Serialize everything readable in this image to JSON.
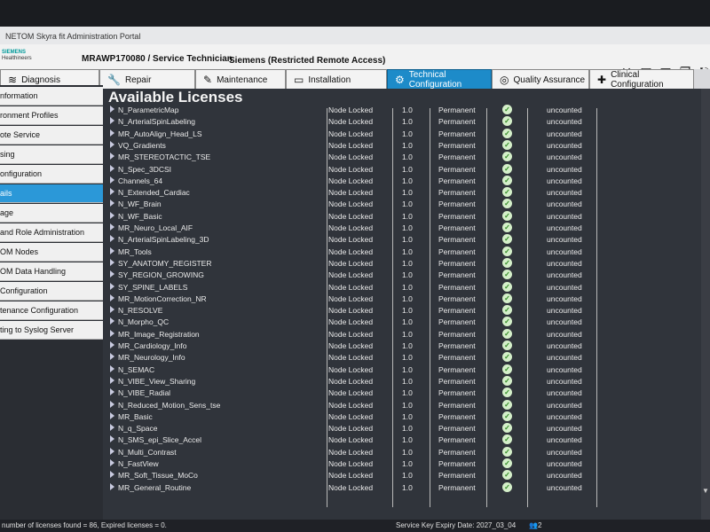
{
  "window": {
    "title": "MAGNETOM Skyra fit Administration Portal",
    "title_visible": "NETOM Skyra fit Administration Portal"
  },
  "header": {
    "logo_line1": "SIEMENS",
    "logo_line2": "Healthineers",
    "system_role": "MRAWP170080 / Service Technician",
    "access": "Siemens (Restricted Remote Access)"
  },
  "tabs": [
    {
      "label": "Diagnosis",
      "icon": "siemens-logo-icon"
    },
    {
      "label": "Repair",
      "icon": "wrench-icon"
    },
    {
      "label": "Maintenance",
      "icon": "edit-icon"
    },
    {
      "label": "Installation",
      "icon": "monitor-icon"
    },
    {
      "label": "Technical Configuration",
      "icon": "gears-icon",
      "active": true
    },
    {
      "label": "Quality Assurance",
      "icon": "award-icon"
    },
    {
      "label": "Clinical Configuration",
      "icon": "plus-icon"
    }
  ],
  "sidebar": {
    "items": [
      {
        "label": "nformation"
      },
      {
        "label": "ronment Profiles"
      },
      {
        "label": "ote Service"
      },
      {
        "label": "sing"
      },
      {
        "label": "onfiguration"
      },
      {
        "label": "ails",
        "active": true
      },
      {
        "label": "age"
      },
      {
        "label": " and Role Administration"
      },
      {
        "label": "OM Nodes"
      },
      {
        "label": "OM Data Handling"
      },
      {
        "label": "Configuration"
      },
      {
        "label": "tenance Configuration"
      },
      {
        "label": "ting to Syslog Server"
      }
    ]
  },
  "content": {
    "title": "Available Licenses",
    "licenses": [
      {
        "name": "N_ParametricMap",
        "type": "Node Locked",
        "count": "1.0",
        "validity": "Permanent",
        "status": "uncounted"
      },
      {
        "name": "N_ArterialSpinLabeling",
        "type": "Node Locked",
        "count": "1.0",
        "validity": "Permanent",
        "status": "uncounted"
      },
      {
        "name": "MR_AutoAlign_Head_LS",
        "type": "Node Locked",
        "count": "1.0",
        "validity": "Permanent",
        "status": "uncounted"
      },
      {
        "name": "VQ_Gradients",
        "type": "Node Locked",
        "count": "1.0",
        "validity": "Permanent",
        "status": "uncounted"
      },
      {
        "name": "MR_STEREOTACTIC_TSE",
        "type": "Node Locked",
        "count": "1.0",
        "validity": "Permanent",
        "status": "uncounted"
      },
      {
        "name": "N_Spec_3DCSI",
        "type": "Node Locked",
        "count": "1.0",
        "validity": "Permanent",
        "status": "uncounted"
      },
      {
        "name": "Channels_64",
        "type": "Node Locked",
        "count": "1.0",
        "validity": "Permanent",
        "status": "uncounted"
      },
      {
        "name": "N_Extended_Cardiac",
        "type": "Node Locked",
        "count": "1.0",
        "validity": "Permanent",
        "status": "uncounted"
      },
      {
        "name": "N_WF_Brain",
        "type": "Node Locked",
        "count": "1.0",
        "validity": "Permanent",
        "status": "uncounted"
      },
      {
        "name": "N_WF_Basic",
        "type": "Node Locked",
        "count": "1.0",
        "validity": "Permanent",
        "status": "uncounted"
      },
      {
        "name": "MR_Neuro_Local_AIF",
        "type": "Node Locked",
        "count": "1.0",
        "validity": "Permanent",
        "status": "uncounted"
      },
      {
        "name": "N_ArterialSpinLabeling_3D",
        "type": "Node Locked",
        "count": "1.0",
        "validity": "Permanent",
        "status": "uncounted"
      },
      {
        "name": "MR_Tools",
        "type": "Node Locked",
        "count": "1.0",
        "validity": "Permanent",
        "status": "uncounted"
      },
      {
        "name": "SY_ANATOMY_REGISTER",
        "type": "Node Locked",
        "count": "1.0",
        "validity": "Permanent",
        "status": "uncounted"
      },
      {
        "name": "SY_REGION_GROWING",
        "type": "Node Locked",
        "count": "1.0",
        "validity": "Permanent",
        "status": "uncounted"
      },
      {
        "name": "SY_SPINE_LABELS",
        "type": "Node Locked",
        "count": "1.0",
        "validity": "Permanent",
        "status": "uncounted"
      },
      {
        "name": "MR_MotionCorrection_NR",
        "type": "Node Locked",
        "count": "1.0",
        "validity": "Permanent",
        "status": "uncounted"
      },
      {
        "name": "N_RESOLVE",
        "type": "Node Locked",
        "count": "1.0",
        "validity": "Permanent",
        "status": "uncounted"
      },
      {
        "name": "N_Morpho_QC",
        "type": "Node Locked",
        "count": "1.0",
        "validity": "Permanent",
        "status": "uncounted"
      },
      {
        "name": "MR_Image_Registration",
        "type": "Node Locked",
        "count": "1.0",
        "validity": "Permanent",
        "status": "uncounted"
      },
      {
        "name": "MR_Cardiology_Info",
        "type": "Node Locked",
        "count": "1.0",
        "validity": "Permanent",
        "status": "uncounted"
      },
      {
        "name": "MR_Neurology_Info",
        "type": "Node Locked",
        "count": "1.0",
        "validity": "Permanent",
        "status": "uncounted"
      },
      {
        "name": "N_SEMAC",
        "type": "Node Locked",
        "count": "1.0",
        "validity": "Permanent",
        "status": "uncounted"
      },
      {
        "name": "N_VIBE_View_Sharing",
        "type": "Node Locked",
        "count": "1.0",
        "validity": "Permanent",
        "status": "uncounted"
      },
      {
        "name": "N_VIBE_Radial",
        "type": "Node Locked",
        "count": "1.0",
        "validity": "Permanent",
        "status": "uncounted"
      },
      {
        "name": "N_Reduced_Motion_Sens_tse",
        "type": "Node Locked",
        "count": "1.0",
        "validity": "Permanent",
        "status": "uncounted"
      },
      {
        "name": "MR_Basic",
        "type": "Node Locked",
        "count": "1.0",
        "validity": "Permanent",
        "status": "uncounted"
      },
      {
        "name": "N_q_Space",
        "type": "Node Locked",
        "count": "1.0",
        "validity": "Permanent",
        "status": "uncounted"
      },
      {
        "name": "N_SMS_epi_Slice_Accel",
        "type": "Node Locked",
        "count": "1.0",
        "validity": "Permanent",
        "status": "uncounted"
      },
      {
        "name": "N_Multi_Contrast",
        "type": "Node Locked",
        "count": "1.0",
        "validity": "Permanent",
        "status": "uncounted"
      },
      {
        "name": "N_FastView",
        "type": "Node Locked",
        "count": "1.0",
        "validity": "Permanent",
        "status": "uncounted"
      },
      {
        "name": "MR_Soft_Tissue_MoCo",
        "type": "Node Locked",
        "count": "1.0",
        "validity": "Permanent",
        "status": "uncounted"
      },
      {
        "name": "MR_General_Routine",
        "type": "Node Locked",
        "count": "1.0",
        "validity": "Permanent",
        "status": "uncounted"
      }
    ]
  },
  "status": {
    "left": "number of licenses found = 86, Expired licenses = 0.",
    "expiry": "Service Key Expiry Date: 2027_03_04",
    "user_count": "2"
  },
  "colors": {
    "accent": "#1d8bc9",
    "content_bg": "#30343b",
    "check_green": "#2f8a22"
  }
}
